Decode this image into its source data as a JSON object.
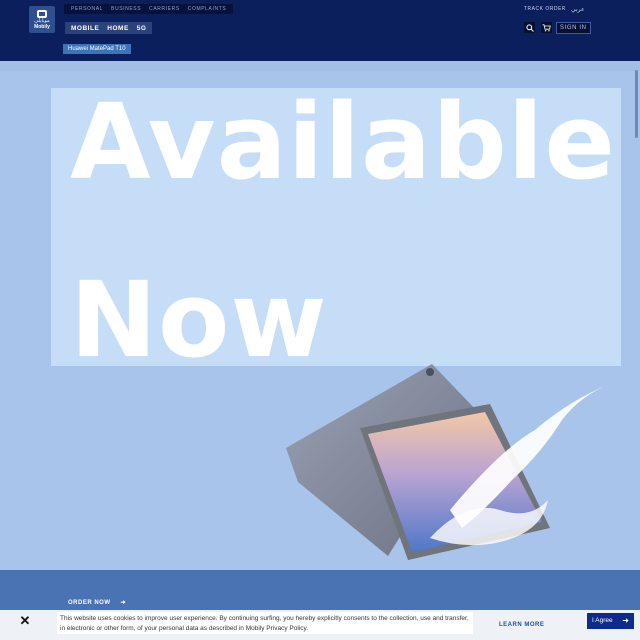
{
  "brand": {
    "logo_ar": "موبايلي",
    "logo_en": "Mobily"
  },
  "top_nav": [
    "PERSONAL",
    "BUSINESS",
    "CARRIERS",
    "COMPLAINTS"
  ],
  "main_nav": [
    "MOBILE",
    "HOME",
    "5G"
  ],
  "breadcrumb": "Huawei MatePad T10",
  "utility": {
    "track_order": "TRACK ORDER",
    "language": "عربي",
    "sign_in": "SIGN IN"
  },
  "hero": {
    "line1": "Available",
    "line2": "Now"
  },
  "order_now": "ORDER NOW",
  "cookie": {
    "text": "This website uses cookies to improve user experience. By continuing surfing, you hereby explicitly consents to the collection, use and transfer, in electronic or other form, of your personal data as described in Mobily Privacy Policy.",
    "learn_more": "LEARN MORE",
    "agree": "I Agree"
  },
  "colors": {
    "header": "#0a1f5c",
    "hero_bg": "#a9c4ea",
    "accent": "#0e2a8a"
  }
}
